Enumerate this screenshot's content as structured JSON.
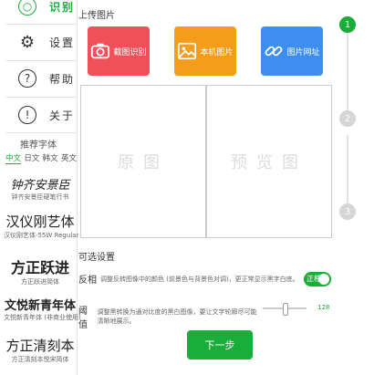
{
  "nav": {
    "items": [
      {
        "label": "识别",
        "icon_char": "○",
        "active": true
      },
      {
        "label": "设置",
        "icon_char": "⚙",
        "active": false
      },
      {
        "label": "帮助",
        "icon_char": "?",
        "active": false
      },
      {
        "label": "关于",
        "icon_char": "!",
        "active": false
      }
    ]
  },
  "fonts": {
    "title": "推荐字体",
    "tabs": [
      "中文",
      "日文",
      "韩文",
      "英文"
    ],
    "samples": [
      {
        "name": "钟齐安景臣",
        "caption": "钟齐安景臣硬笔行书"
      },
      {
        "name": "汉仪刚艺体",
        "caption": "汉仪刚艺体-55W Regular"
      },
      {
        "name": "方正跃进",
        "caption": "方正跃进简体"
      },
      {
        "name": "文悦新青年体",
        "caption": "文悦新青年体 (非商业使用)"
      },
      {
        "name": "方正清刻本",
        "caption": "方正清刻本悦宋简体"
      }
    ]
  },
  "upload": {
    "title": "上传图片",
    "buttons": [
      {
        "label": "截图识别",
        "icon": "camera-icon",
        "color": "#f0505a"
      },
      {
        "label": "本机图片",
        "icon": "image-icon",
        "color": "#f59c1a"
      },
      {
        "label": "图片网址",
        "icon": "link-icon",
        "color": "#3d8ef0"
      }
    ],
    "original_label": "原图",
    "preview_label": "预览图"
  },
  "steps": [
    "1",
    "2",
    "3"
  ],
  "options": {
    "title": "可选设置",
    "invert": {
      "name": "反相",
      "desc": "调整反转图像中的颜色 (前景色与背景色对调)，更正常显示黑字白底。",
      "toggle_label": "正相",
      "enabled": true
    },
    "threshold": {
      "name": "阈值",
      "desc": "调整黑转换为通对比度的黑白图像，要让文字轮廓尽可能清晰地展示。",
      "value": "128",
      "min": 0,
      "max": 255
    }
  },
  "next_label": "下一步",
  "colors": {
    "accent": "#1aad3a",
    "inactive_step": "#d6d6d6"
  }
}
